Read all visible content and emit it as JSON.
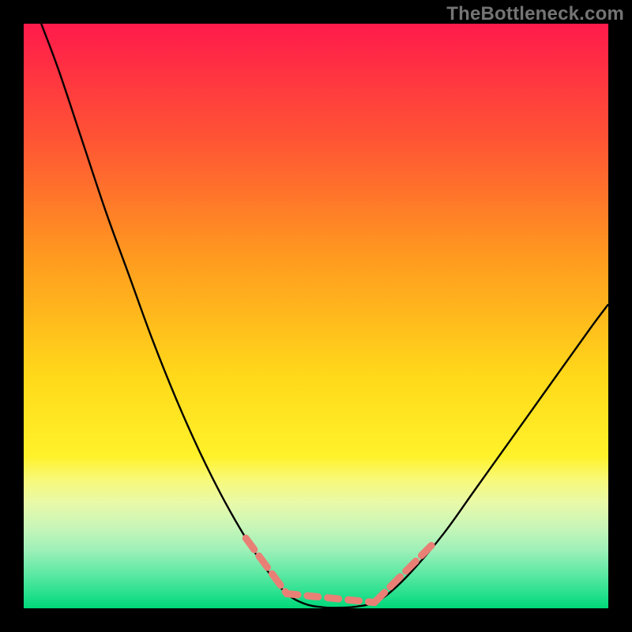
{
  "watermark": "TheBottleneck.com",
  "chart_data": {
    "type": "line",
    "title": "",
    "xlabel": "",
    "ylabel": "",
    "xlim": [
      0,
      100
    ],
    "ylim": [
      0,
      100
    ],
    "background_gradient_stops": [
      {
        "offset": 0,
        "color": "#ff1a4b"
      },
      {
        "offset": 20,
        "color": "#ff5534"
      },
      {
        "offset": 40,
        "color": "#ff9a1f"
      },
      {
        "offset": 60,
        "color": "#ffd81a"
      },
      {
        "offset": 74,
        "color": "#fff22a"
      },
      {
        "offset": 78,
        "color": "#f8f97a"
      },
      {
        "offset": 82,
        "color": "#e8f9a8"
      },
      {
        "offset": 86,
        "color": "#c9f6b8"
      },
      {
        "offset": 90,
        "color": "#9ef0b8"
      },
      {
        "offset": 94,
        "color": "#5fe9a4"
      },
      {
        "offset": 98,
        "color": "#1fdf8a"
      },
      {
        "offset": 100,
        "color": "#00d878"
      }
    ],
    "series": [
      {
        "name": "curve",
        "points": [
          {
            "x": 3,
            "y": 100
          },
          {
            "x": 6,
            "y": 92
          },
          {
            "x": 10,
            "y": 80
          },
          {
            "x": 14,
            "y": 68
          },
          {
            "x": 18,
            "y": 57
          },
          {
            "x": 22,
            "y": 46
          },
          {
            "x": 26,
            "y": 36
          },
          {
            "x": 30,
            "y": 27
          },
          {
            "x": 34,
            "y": 19
          },
          {
            "x": 38,
            "y": 12
          },
          {
            "x": 42,
            "y": 6
          },
          {
            "x": 45,
            "y": 2.5
          },
          {
            "x": 48,
            "y": 0.8
          },
          {
            "x": 51,
            "y": 0.2
          },
          {
            "x": 54,
            "y": 0.1
          },
          {
            "x": 57,
            "y": 0.3
          },
          {
            "x": 60,
            "y": 1
          },
          {
            "x": 63,
            "y": 3
          },
          {
            "x": 67,
            "y": 7
          },
          {
            "x": 72,
            "y": 13
          },
          {
            "x": 77,
            "y": 20
          },
          {
            "x": 82,
            "y": 27
          },
          {
            "x": 87,
            "y": 34
          },
          {
            "x": 92,
            "y": 41
          },
          {
            "x": 97,
            "y": 48
          },
          {
            "x": 100,
            "y": 52
          }
        ]
      },
      {
        "name": "dash-left",
        "points": [
          {
            "x": 38,
            "y": 12
          },
          {
            "x": 45,
            "y": 2.5
          }
        ]
      },
      {
        "name": "dash-bottom",
        "points": [
          {
            "x": 45,
            "y": 2.5
          },
          {
            "x": 60,
            "y": 1
          }
        ]
      },
      {
        "name": "dash-right",
        "points": [
          {
            "x": 60,
            "y": 1
          },
          {
            "x": 70,
            "y": 11
          }
        ]
      }
    ]
  }
}
